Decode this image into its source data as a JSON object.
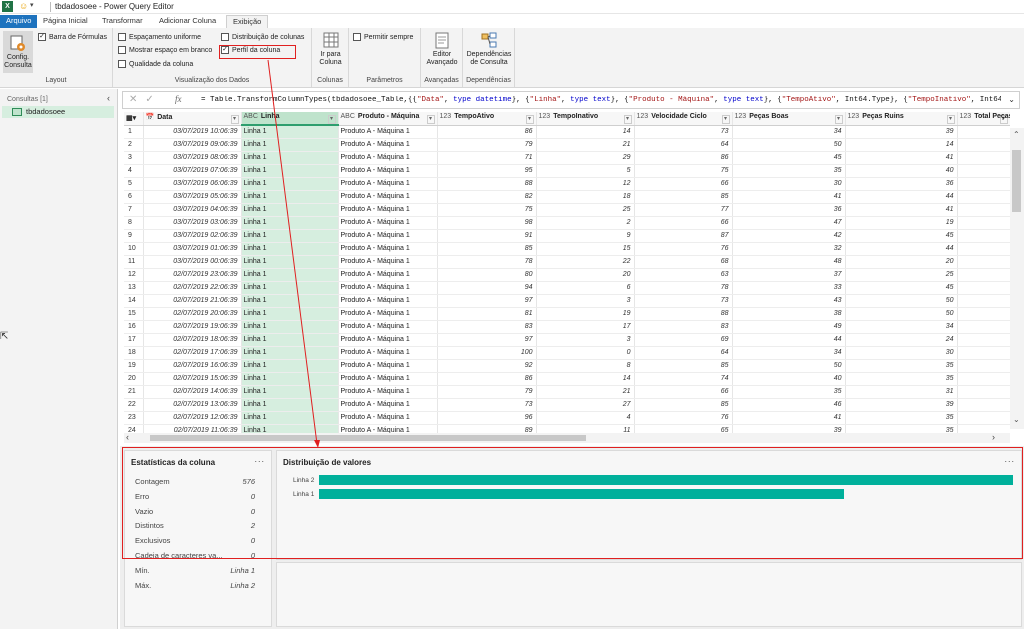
{
  "app": {
    "title": "tbdadosoee - Power Query Editor",
    "excel_icon": "X"
  },
  "tabs": [
    "Arquivo",
    "Página Inicial",
    "Transformar",
    "Adicionar Coluna",
    "Exibição"
  ],
  "ribbon": {
    "layout": {
      "config_label": "Config.",
      "config_label2": "Consulta",
      "formula_bar": "Barra de Fórmulas",
      "group": "Layout"
    },
    "preview": {
      "uniform": "Espaçamento uniforme",
      "whitespace": "Mostrar espaço em branco",
      "quality": "Qualidade da coluna",
      "distribution": "Distribuição de colunas",
      "profile": "Perfil da coluna",
      "group": "Visualização dos Dados"
    },
    "columns": {
      "goto1": "Ir para",
      "goto2": "Coluna",
      "group": "Colunas"
    },
    "params": {
      "allow": "Permitir sempre",
      "group": "Parâmetros"
    },
    "advanced": {
      "l1": "Editor",
      "l2": "Avançado",
      "group": "Avançadas"
    },
    "deps": {
      "l1": "Dependências",
      "l2": "de Consulta",
      "group": "Dependências"
    }
  },
  "queries": {
    "header": "Consultas [1]",
    "items": [
      "tbdadosoee"
    ]
  },
  "formula": {
    "prefix": "= Table.TransformColumnTypes(tbdadosoee_Table,{{",
    "parts": [
      [
        "s",
        "\"Data\""
      ],
      [
        "t",
        ", "
      ],
      [
        "k",
        "type datetime"
      ],
      [
        "t",
        "}, {"
      ],
      [
        "s",
        "\"Linha\""
      ],
      [
        "t",
        ", "
      ],
      [
        "k",
        "type text"
      ],
      [
        "t",
        "}, {"
      ],
      [
        "s",
        "\"Produto - Máquina\""
      ],
      [
        "t",
        ", "
      ],
      [
        "k",
        "type text"
      ],
      [
        "t",
        "}, {"
      ],
      [
        "s",
        "\"TempoAtivo\""
      ],
      [
        "t",
        ", Int64.Type}, {"
      ],
      [
        "s",
        "\"TempoInativo\""
      ],
      [
        "t",
        ", Int64.Type},"
      ]
    ]
  },
  "grid": {
    "columns": [
      {
        "icon": "📅",
        "name": "Data"
      },
      {
        "icon": "ABC",
        "name": "Linha"
      },
      {
        "icon": "ABC",
        "name": "Produto - Máquina"
      },
      {
        "icon": "123",
        "name": "TempoAtivo"
      },
      {
        "icon": "123",
        "name": "TempoInativo"
      },
      {
        "icon": "123",
        "name": "Velocidade Ciclo"
      },
      {
        "icon": "123",
        "name": "Peças Boas"
      },
      {
        "icon": "123",
        "name": "Peças Ruins"
      },
      {
        "icon": "123",
        "name": "Total Peças"
      }
    ],
    "rows": [
      [
        "03/07/2019 10:06:39",
        "Linha 1",
        "Produto A - Máquina 1",
        "86",
        "14",
        "73",
        "34",
        "39"
      ],
      [
        "03/07/2019 09:06:39",
        "Linha 1",
        "Produto A - Máquina 1",
        "79",
        "21",
        "64",
        "50",
        "14"
      ],
      [
        "03/07/2019 08:06:39",
        "Linha 1",
        "Produto A - Máquina 1",
        "71",
        "29",
        "86",
        "45",
        "41"
      ],
      [
        "03/07/2019 07:06:39",
        "Linha 1",
        "Produto A - Máquina 1",
        "95",
        "5",
        "75",
        "35",
        "40"
      ],
      [
        "03/07/2019 06:06:39",
        "Linha 1",
        "Produto A - Máquina 1",
        "88",
        "12",
        "66",
        "30",
        "36"
      ],
      [
        "03/07/2019 05:06:39",
        "Linha 1",
        "Produto A - Máquina 1",
        "82",
        "18",
        "85",
        "41",
        "44"
      ],
      [
        "03/07/2019 04:06:39",
        "Linha 1",
        "Produto A - Máquina 1",
        "75",
        "25",
        "77",
        "36",
        "41"
      ],
      [
        "03/07/2019 03:06:39",
        "Linha 1",
        "Produto A - Máquina 1",
        "98",
        "2",
        "66",
        "47",
        "19"
      ],
      [
        "03/07/2019 02:06:39",
        "Linha 1",
        "Produto A - Máquina 1",
        "91",
        "9",
        "87",
        "42",
        "45"
      ],
      [
        "03/07/2019 01:06:39",
        "Linha 1",
        "Produto A - Máquina 1",
        "85",
        "15",
        "76",
        "32",
        "44"
      ],
      [
        "03/07/2019 00:06:39",
        "Linha 1",
        "Produto A - Máquina 1",
        "78",
        "22",
        "68",
        "48",
        "20"
      ],
      [
        "02/07/2019 23:06:39",
        "Linha 1",
        "Produto A - Máquina 1",
        "80",
        "20",
        "63",
        "37",
        "25"
      ],
      [
        "02/07/2019 22:06:39",
        "Linha 1",
        "Produto A - Máquina 1",
        "94",
        "6",
        "78",
        "33",
        "45"
      ],
      [
        "02/07/2019 21:06:39",
        "Linha 1",
        "Produto A - Máquina 1",
        "97",
        "3",
        "73",
        "43",
        "50"
      ],
      [
        "02/07/2019 20:06:39",
        "Linha 1",
        "Produto A - Máquina 1",
        "81",
        "19",
        "88",
        "38",
        "50"
      ],
      [
        "02/07/2019 19:06:39",
        "Linha 1",
        "Produto A - Máquina 1",
        "83",
        "17",
        "83",
        "49",
        "34"
      ],
      [
        "02/07/2019 18:06:39",
        "Linha 1",
        "Produto A - Máquina 1",
        "97",
        "3",
        "69",
        "44",
        "24"
      ],
      [
        "02/07/2019 17:06:39",
        "Linha 1",
        "Produto A - Máquina 1",
        "100",
        "0",
        "64",
        "34",
        "30"
      ],
      [
        "02/07/2019 16:06:39",
        "Linha 1",
        "Produto A - Máquina 1",
        "92",
        "8",
        "85",
        "50",
        "35"
      ],
      [
        "02/07/2019 15:06:39",
        "Linha 1",
        "Produto A - Máquina 1",
        "86",
        "14",
        "74",
        "40",
        "35"
      ],
      [
        "02/07/2019 14:06:39",
        "Linha 1",
        "Produto A - Máquina 1",
        "79",
        "21",
        "66",
        "35",
        "31"
      ],
      [
        "02/07/2019 13:06:39",
        "Linha 1",
        "Produto A - Máquina 1",
        "73",
        "27",
        "85",
        "46",
        "39"
      ],
      [
        "02/07/2019 12:06:39",
        "Linha 1",
        "Produto A - Máquina 1",
        "96",
        "4",
        "76",
        "41",
        "35"
      ],
      [
        "02/07/2019 11:06:39",
        "Linha 1",
        "Produto A - Máquina 1",
        "89",
        "11",
        "65",
        "39",
        "35"
      ]
    ]
  },
  "profile": {
    "stats_title": "Estatísticas da coluna",
    "stats": [
      [
        "Contagem",
        "576"
      ],
      [
        "Erro",
        "0"
      ],
      [
        "Vazio",
        "0"
      ],
      [
        "Distintos",
        "2"
      ],
      [
        "Exclusivos",
        "0"
      ],
      [
        "Cadeia de caracteres va...",
        "0"
      ],
      [
        "Mín.",
        "Linha 1"
      ],
      [
        "Máx.",
        "Linha 2"
      ]
    ],
    "dist_title": "Distribuição de valores",
    "more": "..."
  },
  "chart_data": {
    "type": "bar",
    "orientation": "horizontal",
    "title": "Distribuição de valores",
    "categories": [
      "Linha 2",
      "Linha 1"
    ],
    "values": [
      328,
      248
    ],
    "note_values_estimated": true
  },
  "colors": {
    "accent": "#00b09b",
    "file_tab": "#1e73be",
    "highlight": "#e02020"
  }
}
